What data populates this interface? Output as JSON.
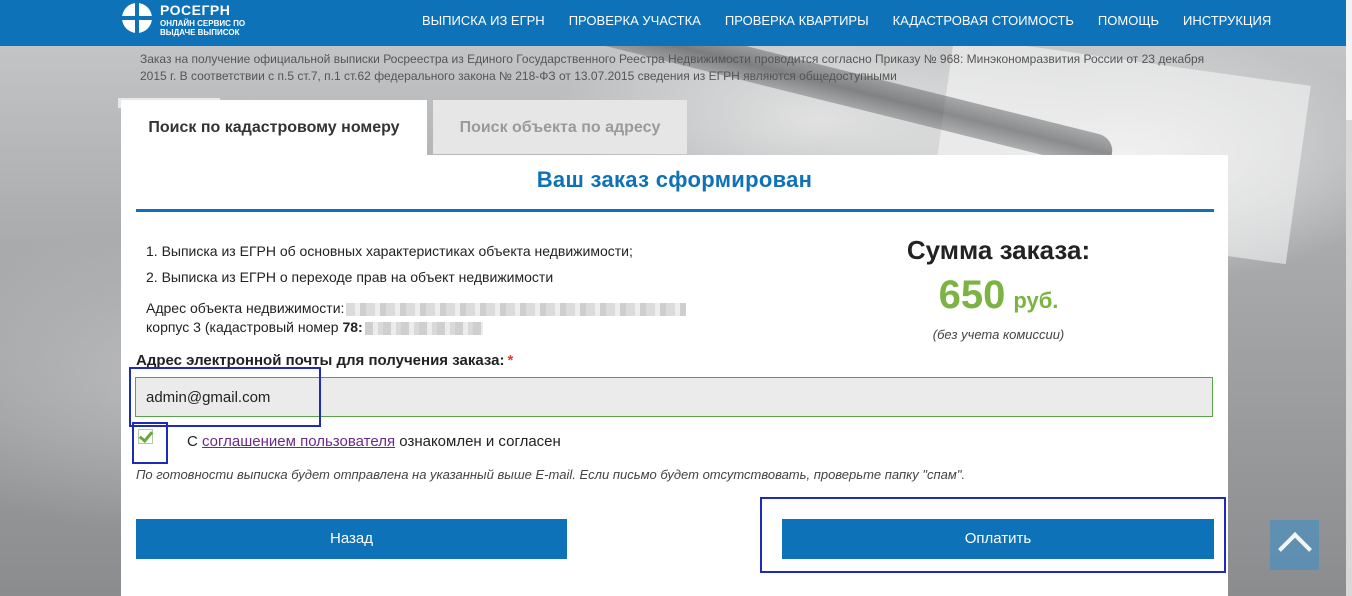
{
  "header": {
    "logo_title": "РОСЕГРН",
    "logo_subtitle": "ОНЛАЙН СЕРВИС ПО ВЫДАЧЕ ВЫПИСОК",
    "nav": [
      "ВЫПИСКА ИЗ ЕГРН",
      "ПРОВЕРКА УЧАСТКА",
      "ПРОВЕРКА КВАРТИРЫ",
      "КАДАСТРОВАЯ СТОИМОСТЬ",
      "ПОМОЩЬ",
      "ИНСТРУКЦИЯ"
    ]
  },
  "notice": "Заказ на получение официальной выписки Росреестра из Единого Государственного Реестра Недвижимости проводится согласно Приказу № 968: Минэкономразвития России от 23 декабря 2015 г. В соответствии с п.5 ст.7, п.1 ст.62 федерального закона № 218-ФЗ от 13.07.2015 сведения из ЕГРН являются общедоступными",
  "tabs": {
    "active": "Поиск по кадастровому номеру",
    "inactive": "Поиск объекта по адресу"
  },
  "order": {
    "title": "Ваш заказ сформирован",
    "items": [
      "1. Выписка из ЕГРН об основных характеристиках объекта недвижимости;",
      "2. Выписка из ЕГРН о переходе прав на объект недвижимости"
    ],
    "address_label": "Адрес объекта недвижимости:",
    "address_line2_prefix": "корпус 3 (кадастровый номер ",
    "cadastral_prefix": "78:"
  },
  "sum": {
    "label": "Сумма заказа:",
    "amount": "650",
    "currency": "руб.",
    "note": "(без учета комиссии)"
  },
  "email": {
    "label": "Адрес электронной почты для получения заказа:",
    "required_mark": "*",
    "value": "admin@gmail.com"
  },
  "agreement": {
    "prefix": "С ",
    "link": "соглашением пользователя",
    "suffix": " ознакомлен и согласен",
    "checked": true
  },
  "hint": "По готовности выписка будет отправлена на указанный выше E-mail. Если письмо будет отсутствовать, проверьте папку \"спам\".",
  "buttons": {
    "back": "Назад",
    "pay": "Оплатить"
  },
  "colors": {
    "brand_blue": "#0e72b8",
    "price_green": "#7cb342",
    "highlight_frame": "#1e2ab8"
  }
}
